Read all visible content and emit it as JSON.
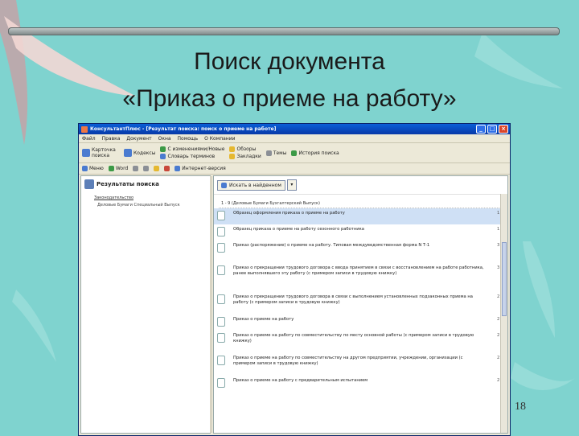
{
  "slide": {
    "title_line1": "Поиск документа",
    "title_line2": "«Приказ о приеме на работу»",
    "page_number": "18"
  },
  "window": {
    "title": "КонсультантПлюс - [Результат поиска: поиск о приеме на работе]",
    "menu": [
      "Файл",
      "Правка",
      "Документ",
      "Окна",
      "Помощь",
      "О Компании"
    ],
    "toolbar": {
      "card_search": "Карточка поиска",
      "codes": "Кодексы",
      "recent_changes": "С изменениями/Новые",
      "overview": "Обзоры",
      "dictionary": "Словарь терминов",
      "topics": "Темы",
      "history": "История поиска",
      "notes": "Закладки"
    },
    "toolbar2": {
      "menu": "Меню",
      "word": "Word",
      "internet": "Интернет-версия"
    }
  },
  "left_pane": {
    "heading": "Результаты поиска",
    "subheading": "Законодательство",
    "item": "Деловые Бумаги Специальный Выпуск"
  },
  "right_pane": {
    "find_button": "Искать в найденном",
    "group_header": "1 - 9 (Деловые Бумаги Бухгалтерский Выпуск)",
    "rows": [
      {
        "title": "Образец оформления приказа о приеме на работу",
        "num": "1 ◁"
      },
      {
        "title": "Образец приказа о приеме на работу сезонного работника",
        "num": "1 ◁"
      },
      {
        "title": "Приказ (распоряжение) о приеме на работу. Типовая междуведомственная форма N Т-1",
        "num": "3 ◁"
      },
      {
        "title": "Приказ о прекращении трудового договора с ввода принятием в связи с восстановлением на работе работника, ранее выполнявшего эту работу (с примером записи в трудовую книжку)",
        "num": "3 ◁"
      },
      {
        "title": "Приказ о прекращении трудового договора в связи с выполнением установленных подзаконных приема на работу (с примером записи в трудовую книжку)",
        "num": "2 ◁"
      },
      {
        "title": "Приказ о приеме на работу",
        "num": "2 ◁"
      },
      {
        "title": "Приказ о приеме на работу по совместительству по месту основной работы (с примером записи в трудовую книжку)",
        "num": "2 ◁"
      },
      {
        "title": "Приказ о приеме на работу по совместительству на другом предприятии, учреждении, организации (с примером записи в трудовую книжку)",
        "num": "2 ◁"
      },
      {
        "title": "Приказ о приеме на работу с предварительным испытанием",
        "num": "2 ◁"
      }
    ]
  }
}
